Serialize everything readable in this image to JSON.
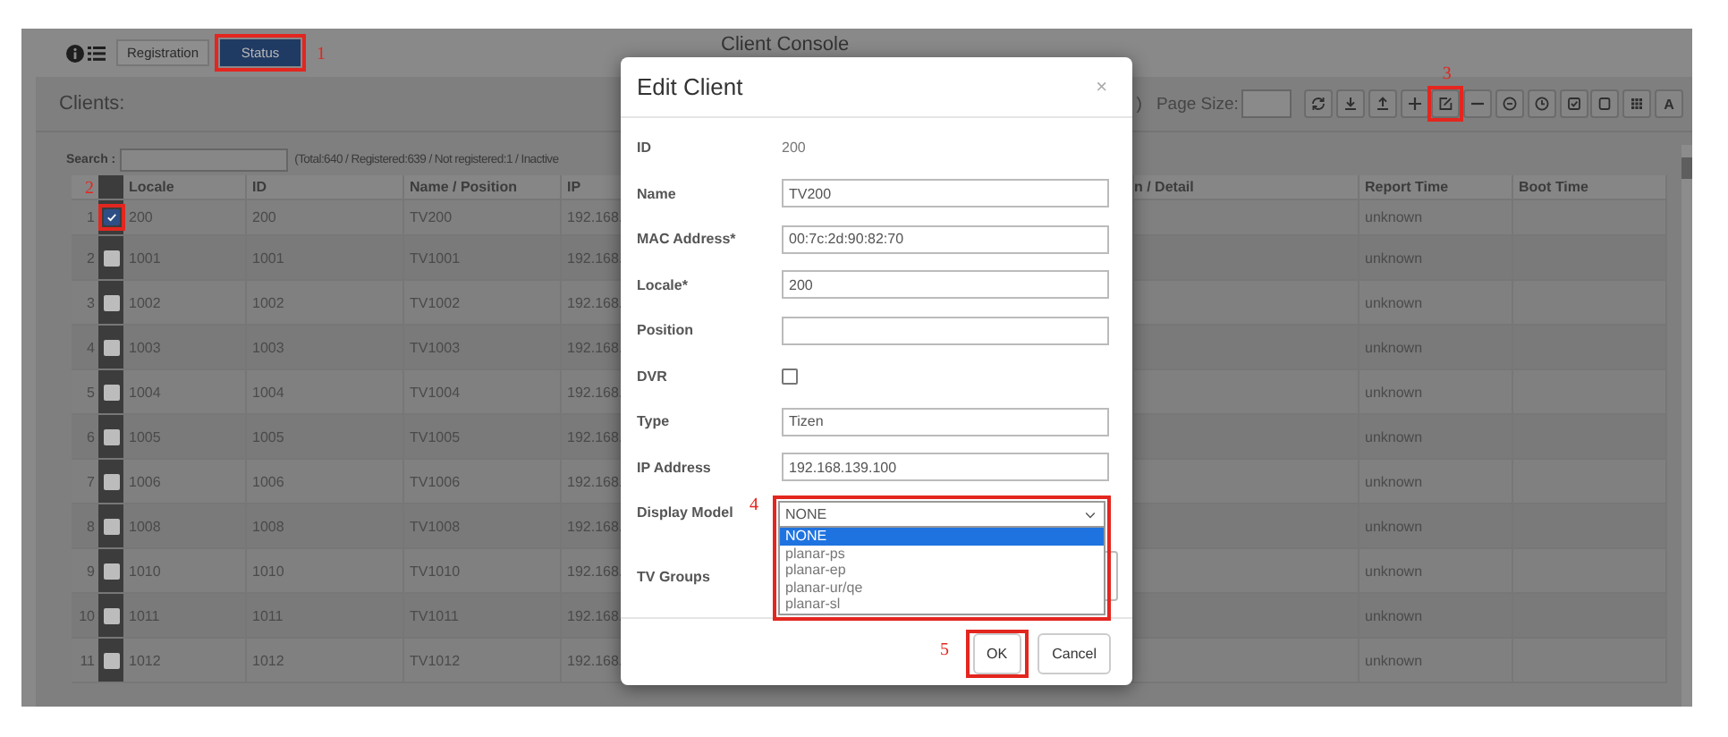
{
  "topbar": {
    "title": "Client Console",
    "tabs": [
      {
        "label": "Registration",
        "selected": false
      },
      {
        "label": "Status",
        "selected": true,
        "callout": "1"
      }
    ]
  },
  "clients": {
    "title": "Clients:",
    "fragment": ")",
    "page_size_label": "Page Size:",
    "toolbar": [
      {
        "kind": "icon"
      },
      {
        "kind": "icon"
      },
      {
        "kind": "icon"
      },
      {
        "kind": "icon"
      },
      {
        "kind": "icon",
        "callout": "3"
      },
      {
        "kind": "icon"
      },
      {
        "kind": "icon"
      },
      {
        "kind": "icon"
      },
      {
        "kind": "icon"
      },
      {
        "kind": "icon"
      },
      {
        "kind": "icon"
      },
      {
        "kind": "text",
        "label": "A"
      }
    ],
    "search_label": "Search :",
    "summary": "(Total:640 / Registered:639 / Not registered:1 / Inactive",
    "table": {
      "columns": [
        "Locale",
        "ID",
        "Name / Position",
        "IP",
        "n / Detail",
        "Report Time",
        "Boot Time"
      ],
      "rows": [
        {
          "number": "1",
          "checked": true,
          "callout": "2",
          "locale": "200",
          "id": "200",
          "name": "TV200",
          "ip": "192.168.",
          "report_time": "unknown"
        },
        {
          "number": "2",
          "checked": false,
          "locale": "1001",
          "id": "1001",
          "name": "TV1001",
          "ip": "192.168.",
          "report_time": "unknown"
        },
        {
          "number": "3",
          "checked": false,
          "locale": "1002",
          "id": "1002",
          "name": "TV1002",
          "ip": "192.168.",
          "report_time": "unknown"
        },
        {
          "number": "4",
          "checked": false,
          "locale": "1003",
          "id": "1003",
          "name": "TV1003",
          "ip": "192.168.",
          "report_time": "unknown"
        },
        {
          "number": "5",
          "checked": false,
          "locale": "1004",
          "id": "1004",
          "name": "TV1004",
          "ip": "192.168.",
          "report_time": "unknown"
        },
        {
          "number": "6",
          "checked": false,
          "locale": "1005",
          "id": "1005",
          "name": "TV1005",
          "ip": "192.168.",
          "report_time": "unknown"
        },
        {
          "number": "7",
          "checked": false,
          "locale": "1006",
          "id": "1006",
          "name": "TV1006",
          "ip": "192.168.",
          "report_time": "unknown"
        },
        {
          "number": "8",
          "checked": false,
          "locale": "1008",
          "id": "1008",
          "name": "TV1008",
          "ip": "192.168.",
          "report_time": "unknown"
        },
        {
          "number": "9",
          "checked": false,
          "locale": "1010",
          "id": "1010",
          "name": "TV1010",
          "ip": "192.168.",
          "report_time": "unknown"
        },
        {
          "number": "10",
          "checked": false,
          "locale": "1011",
          "id": "1011",
          "name": "TV1011",
          "ip": "192.168.",
          "report_time": "unknown"
        },
        {
          "number": "11",
          "checked": false,
          "locale": "1012",
          "id": "1012",
          "name": "TV1012",
          "ip": "192.168.",
          "report_time": "unknown"
        }
      ]
    }
  },
  "modal": {
    "title": "Edit Client",
    "close": "×",
    "fields": [
      {
        "kind": "static",
        "label": "ID",
        "value": "200"
      },
      {
        "kind": "input",
        "label": "Name",
        "value": "TV200"
      },
      {
        "kind": "input",
        "label": "MAC Address*",
        "value": "00:7c:2d:90:82:70"
      },
      {
        "kind": "input",
        "label": "Locale*",
        "value": "200"
      },
      {
        "kind": "input",
        "label": "Position"
      },
      {
        "kind": "checkbox",
        "label": "DVR",
        "checked": false
      },
      {
        "kind": "input",
        "label": "Type",
        "value": "Tizen"
      },
      {
        "kind": "input",
        "label": "IP Address",
        "value": "192.168.139.100"
      },
      {
        "kind": "select",
        "label": "Display Model",
        "value": "NONE",
        "expanded": true,
        "callout": "4",
        "options": [
          {
            "label": "NONE",
            "selected": true
          },
          {
            "label": "planar-ps",
            "selected": false
          },
          {
            "label": "planar-ep",
            "selected": false
          },
          {
            "label": "planar-ur/qe",
            "selected": false
          },
          {
            "label": "planar-sl",
            "selected": false
          }
        ]
      },
      {
        "kind": "multiselect",
        "label": "TV Groups"
      }
    ],
    "buttons": [
      {
        "label": "OK",
        "callout": "5"
      },
      {
        "label": "Cancel"
      }
    ]
  }
}
